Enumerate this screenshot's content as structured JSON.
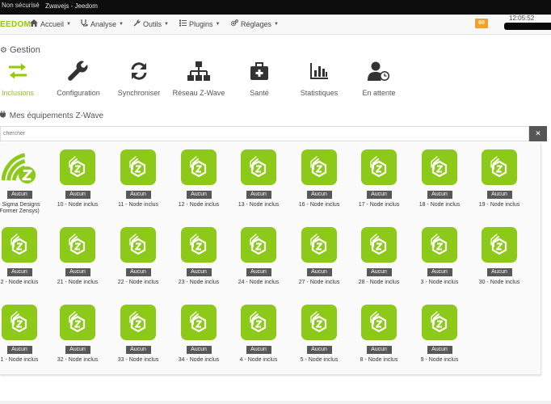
{
  "browser": {
    "security_label": "Non sécurisé",
    "tab_title": "Zwavejs - Jeedom"
  },
  "navbar": {
    "brand": "EEDOM",
    "items": [
      {
        "label": "Accueil",
        "icon": "home-icon"
      },
      {
        "label": "Analyse",
        "icon": "stethoscope-icon"
      },
      {
        "label": "Outils",
        "icon": "wrench-icon"
      },
      {
        "label": "Plugins",
        "icon": "list-icon"
      },
      {
        "label": "Réglages",
        "icon": "cogs-icon"
      }
    ],
    "badge": "60",
    "clock": "12:05:52"
  },
  "gestion": {
    "title": "Gestion",
    "cards": [
      {
        "label": "Inclusions",
        "icon": "exchange-arrows-icon",
        "active": true
      },
      {
        "label": "Configuration",
        "icon": "wrench-icon"
      },
      {
        "label": "Synchroniser",
        "icon": "sync-icon"
      },
      {
        "label": "Réseau Z-Wave",
        "icon": "network-icon"
      },
      {
        "label": "Santé",
        "icon": "medkit-icon"
      },
      {
        "label": "Statistiques",
        "icon": "bar-chart-icon"
      },
      {
        "label": "En attente",
        "icon": "user-clock-icon"
      }
    ]
  },
  "equipements": {
    "title": "Mes équipements Z-Wave",
    "search_placeholder": "chercher",
    "clear_label": "✕",
    "devices": [
      {
        "tag": "Aucun",
        "name1": "- Sigma Designs",
        "name2": "Former Zensys)",
        "icon": "zwave-controller-icon"
      },
      {
        "tag": "Aucun",
        "name1": "10 - Node inclus"
      },
      {
        "tag": "Aucun",
        "name1": "11 - Node inclus"
      },
      {
        "tag": "Aucun",
        "name1": "12 - Node inclus"
      },
      {
        "tag": "Aucun",
        "name1": "13 - Node inclus"
      },
      {
        "tag": "Aucun",
        "name1": "16 - Node inclus"
      },
      {
        "tag": "Aucun",
        "name1": "17 - Node inclus"
      },
      {
        "tag": "Aucun",
        "name1": "18 - Node inclus"
      },
      {
        "tag": "Aucun",
        "name1": "19 - Node inclus"
      },
      {
        "tag": "Aucun",
        "name1": "2 - Node inclus"
      },
      {
        "tag": "Aucun",
        "name1": "21 - Node inclus"
      },
      {
        "tag": "Aucun",
        "name1": "22 - Node inclus"
      },
      {
        "tag": "Aucun",
        "name1": "23 - Node inclus"
      },
      {
        "tag": "Aucun",
        "name1": "24 - Node inclus"
      },
      {
        "tag": "Aucun",
        "name1": "27 - Node inclus"
      },
      {
        "tag": "Aucun",
        "name1": "28 - Node inclus"
      },
      {
        "tag": "Aucun",
        "name1": "3 - Node inclus"
      },
      {
        "tag": "Aucun",
        "name1": "30 - Node inclus"
      },
      {
        "tag": "Aucun",
        "name1": "1 - Node inclus"
      },
      {
        "tag": "Aucun",
        "name1": "32 - Node inclus"
      },
      {
        "tag": "Aucun",
        "name1": "33 - Node inclus"
      },
      {
        "tag": "Aucun",
        "name1": "34 - Node inclus"
      },
      {
        "tag": "Aucun",
        "name1": "4 - Node inclus"
      },
      {
        "tag": "Aucun",
        "name1": "5 - Node inclus"
      },
      {
        "tag": "Aucun",
        "name1": "8 - Node inclus"
      },
      {
        "tag": "Aucun",
        "name1": "9 - Node inclus"
      }
    ]
  },
  "colors": {
    "accent": "#94ca02",
    "device_tile": "#8cc919",
    "tag_bg": "#585858",
    "badge": "#f0a030"
  }
}
